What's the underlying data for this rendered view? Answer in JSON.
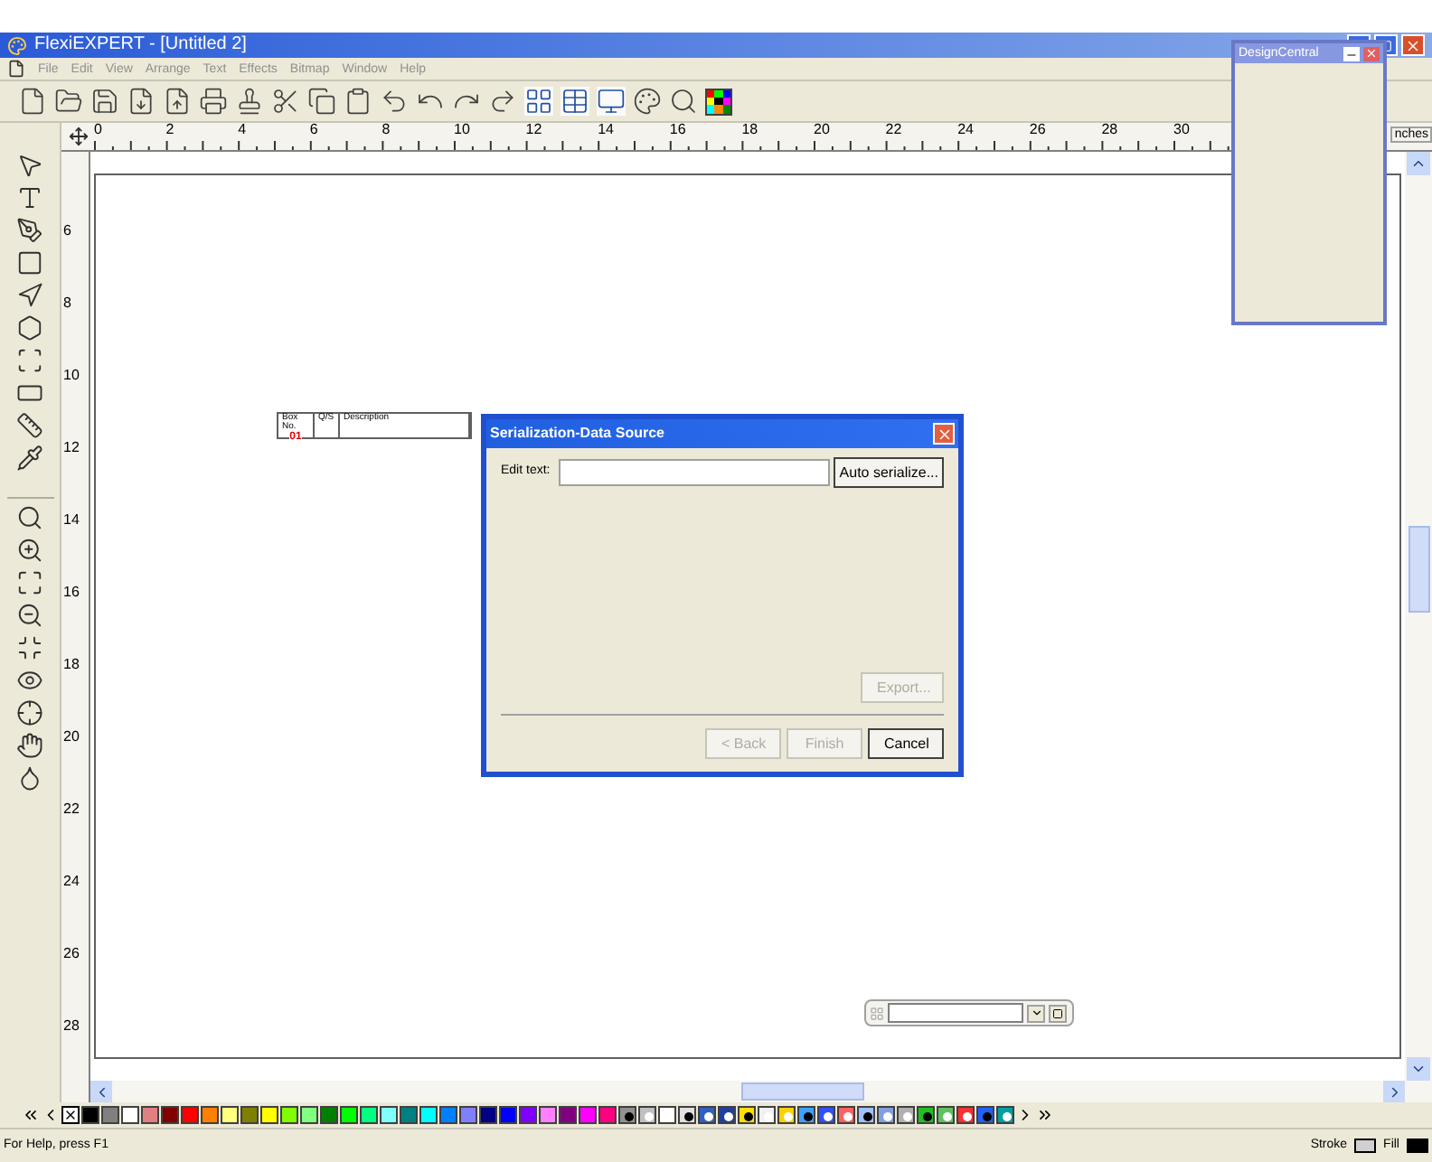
{
  "window": {
    "title": "FlexiEXPERT - [Untitled 2]"
  },
  "menu": [
    "File",
    "Edit",
    "View",
    "Arrange",
    "Text",
    "Effects",
    "Bitmap",
    "Window",
    "Help"
  ],
  "ruler": {
    "unit": "nches",
    "horizontal": [
      "0",
      "2",
      "4",
      "6",
      "8",
      "10",
      "12",
      "14",
      "16",
      "18",
      "20",
      "22",
      "24",
      "26",
      "28",
      "30"
    ],
    "vertical": [
      "6",
      "8",
      "10",
      "12",
      "14",
      "16",
      "18",
      "20",
      "22",
      "24",
      "26",
      "28"
    ]
  },
  "document_table": {
    "columns": [
      {
        "label": "Box No.",
        "value": "01"
      },
      {
        "label": "Q/S"
      },
      {
        "label": "Description"
      }
    ]
  },
  "dialog": {
    "title": "Serialization-Data Source",
    "field_label": "Edit text:",
    "side_buttons": [
      {
        "label": "Auto serialize...",
        "disabled": false
      },
      {
        "label": "Export...",
        "disabled": true
      }
    ],
    "footer_buttons": [
      {
        "label": "< Back",
        "disabled": true
      },
      {
        "label": "Finish",
        "disabled": true
      },
      {
        "label": "Cancel",
        "disabled": false
      }
    ]
  },
  "design_central": {
    "title": "DesignCentral"
  },
  "palette": [
    {
      "color": "#000000"
    },
    {
      "color": "#808080"
    },
    {
      "color": "#ffffff"
    },
    {
      "color": "#e08080"
    },
    {
      "color": "#800000"
    },
    {
      "color": "#ff0000"
    },
    {
      "color": "#ff8000"
    },
    {
      "color": "#ffff80"
    },
    {
      "color": "#808000"
    },
    {
      "color": "#ffff00"
    },
    {
      "color": "#80ff00"
    },
    {
      "color": "#80ff80"
    },
    {
      "color": "#008000"
    },
    {
      "color": "#00ff00"
    },
    {
      "color": "#00ff80"
    },
    {
      "color": "#80ffff"
    },
    {
      "color": "#008080"
    },
    {
      "color": "#00ffff"
    },
    {
      "color": "#0080ff"
    },
    {
      "color": "#8080ff"
    },
    {
      "color": "#000080"
    },
    {
      "color": "#0000ff"
    },
    {
      "color": "#8000ff"
    },
    {
      "color": "#ff80ff"
    },
    {
      "color": "#800080"
    },
    {
      "color": "#ff00ff"
    },
    {
      "color": "#ff0080"
    }
  ],
  "status_bar": {
    "text": "For Help, press F1",
    "stroke_label": "Stroke",
    "fill_label": "Fill"
  }
}
